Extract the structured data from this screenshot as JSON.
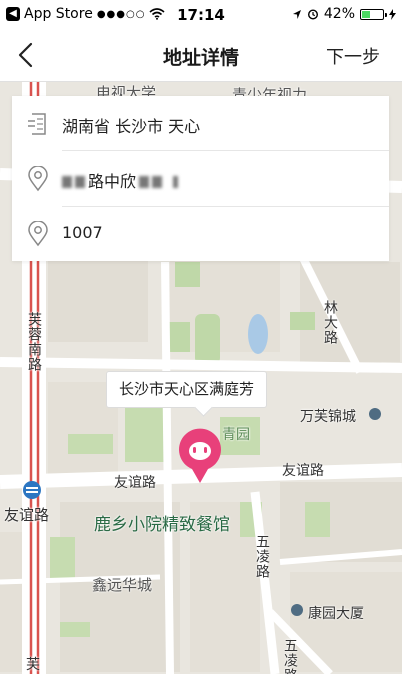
{
  "status_bar": {
    "back_app": "App Store",
    "signal": "●●●○○",
    "time": "17:14",
    "battery_percent": "42%",
    "battery_level": 0.42
  },
  "nav": {
    "title": "地址详情",
    "next_label": "下一步"
  },
  "info": {
    "region": "湖南省  长沙市  天心",
    "street_visible": "路中欣",
    "number": "1007"
  },
  "map": {
    "callout": "长沙市天心区满庭芳",
    "labels": {
      "top_left": "电视大学",
      "top_right": "青少年视力",
      "lin_da_road": "林大路",
      "furong_south": "芙蓉南路",
      "wanfu": "万芙锦城",
      "qingyuan": "青园",
      "youyi_left": "友谊路",
      "youyi_right": "友谊路",
      "youyi_station": "友谊路",
      "restaurant": "鹿乡小院精致餐馆",
      "wuling": "五凌路",
      "xinyuan": "鑫远华城",
      "kangyuan": "康园大厦",
      "wuling_bottom": "五凌路",
      "furong_bottom": "芙"
    }
  }
}
